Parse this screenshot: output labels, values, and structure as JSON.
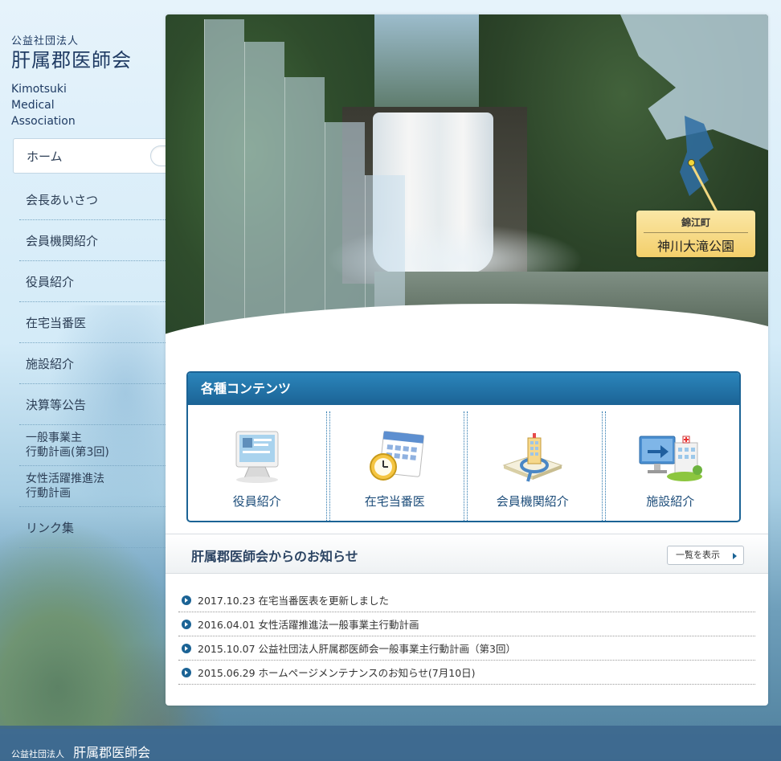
{
  "logo": {
    "org_type": "公益社団法人",
    "org_name": "肝属郡医師会",
    "en_line1": "Kimotsuki",
    "en_line2": "Medical",
    "en_line3": "Association"
  },
  "nav": {
    "items": [
      {
        "label": "ホーム"
      },
      {
        "label": "会長あいさつ"
      },
      {
        "label": "会員機関紹介"
      },
      {
        "label": "役員紹介"
      },
      {
        "label": "在宅当番医"
      },
      {
        "label": "施設紹介"
      },
      {
        "label": "決算等公告"
      },
      {
        "label_line1": "一般事業主",
        "label_line2": "行動計画(第3回)"
      },
      {
        "label_line1": "女性活躍推進法",
        "label_line2": "行動計画"
      },
      {
        "label": "リンク集"
      }
    ]
  },
  "hero": {
    "town": "錦江町",
    "park": "神川大滝公園"
  },
  "contents": {
    "title": "各種コンテンツ",
    "items": [
      {
        "label": "役員紹介",
        "icon": "monitor-icon"
      },
      {
        "label": "在宅当番医",
        "icon": "calendar-clock-icon"
      },
      {
        "label": "会員機関紹介",
        "icon": "building-magnifier-icon"
      },
      {
        "label": "施設紹介",
        "icon": "facility-icon"
      }
    ]
  },
  "news": {
    "title": "肝属郡医師会からのお知らせ",
    "more_label": "一覧を表示",
    "items": [
      {
        "text": "2017.10.23 在宅当番医表を更新しました"
      },
      {
        "text": "2016.04.01 女性活躍推進法一般事業主行動計画"
      },
      {
        "text": "2015.10.07 公益社団法人肝属郡医師会一般事業主行動計画（第3回）"
      },
      {
        "text": "2015.06.29 ホームページメンテナンスのお知らせ(7月10日)"
      }
    ]
  },
  "footer": {
    "org_type": "公益社団法人",
    "org_name": "肝属郡医師会"
  },
  "colors": {
    "accent": "#1b6395",
    "nav_text": "#2c3e55",
    "label_gold": "#f3cf6b"
  }
}
